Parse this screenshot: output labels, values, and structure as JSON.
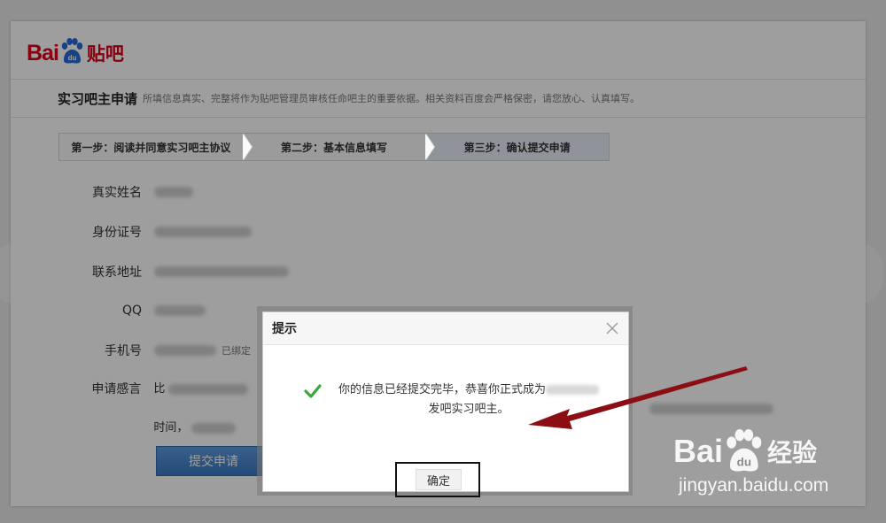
{
  "brand": {
    "logo_part1": "Bai",
    "logo_part2": "du",
    "logo_part3": "贴吧"
  },
  "header": {
    "title": "实习吧主申请",
    "description": "所填信息真实、完整将作为贴吧管理员审核任命吧主的重要依据。相关资料百度会严格保密，请您放心、认真填写。"
  },
  "steps": [
    {
      "label": "第一步：阅读并同意实习吧主协议"
    },
    {
      "label": "第二步：基本信息填写"
    },
    {
      "label": "第三步：确认提交申请"
    }
  ],
  "form": {
    "fields": [
      {
        "label": "真实姓名"
      },
      {
        "label": "身份证号"
      },
      {
        "label": "联系地址"
      },
      {
        "label": "QQ"
      },
      {
        "label": "手机号",
        "note": "已绑定"
      },
      {
        "label": "申请感言",
        "line1_start": "比",
        "line2_start": "时间，"
      }
    ],
    "submit_label": "提交申请"
  },
  "dialog": {
    "title": "提示",
    "message_part1": "你的信息已经提交完毕，恭喜你正式成为",
    "message_part2": "发吧实习吧主。",
    "confirm_label": "确定"
  },
  "watermark": {
    "brand_a": "Bai",
    "brand_b": "du",
    "brand_c": "经验",
    "url": "jingyan.baidu.com"
  },
  "colors": {
    "brand_red": "#d9001b",
    "submit_blue": "#3a78c2",
    "success_green": "#3aa836",
    "annotation_arrow": "#8b0e14"
  },
  "icons": [
    "baidu-paw-icon",
    "check-icon",
    "close-icon",
    "arrow-left-icon",
    "arrow-right-icon"
  ]
}
